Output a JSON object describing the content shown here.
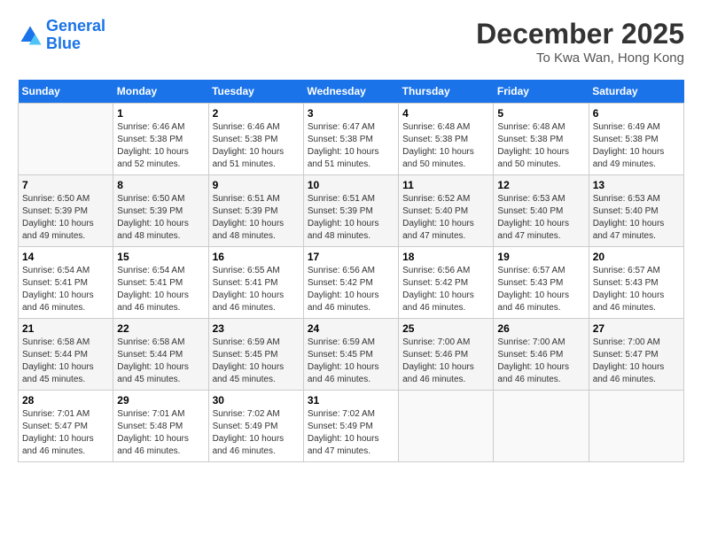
{
  "logo": {
    "line1": "General",
    "line2": "Blue"
  },
  "title": "December 2025",
  "subtitle": "To Kwa Wan, Hong Kong",
  "days_of_week": [
    "Sunday",
    "Monday",
    "Tuesday",
    "Wednesday",
    "Thursday",
    "Friday",
    "Saturday"
  ],
  "weeks": [
    [
      {
        "day": "",
        "sunrise": "",
        "sunset": "",
        "daylight": "",
        "empty": true
      },
      {
        "day": "1",
        "sunrise": "Sunrise: 6:46 AM",
        "sunset": "Sunset: 5:38 PM",
        "daylight": "Daylight: 10 hours and 52 minutes."
      },
      {
        "day": "2",
        "sunrise": "Sunrise: 6:46 AM",
        "sunset": "Sunset: 5:38 PM",
        "daylight": "Daylight: 10 hours and 51 minutes."
      },
      {
        "day": "3",
        "sunrise": "Sunrise: 6:47 AM",
        "sunset": "Sunset: 5:38 PM",
        "daylight": "Daylight: 10 hours and 51 minutes."
      },
      {
        "day": "4",
        "sunrise": "Sunrise: 6:48 AM",
        "sunset": "Sunset: 5:38 PM",
        "daylight": "Daylight: 10 hours and 50 minutes."
      },
      {
        "day": "5",
        "sunrise": "Sunrise: 6:48 AM",
        "sunset": "Sunset: 5:38 PM",
        "daylight": "Daylight: 10 hours and 50 minutes."
      },
      {
        "day": "6",
        "sunrise": "Sunrise: 6:49 AM",
        "sunset": "Sunset: 5:38 PM",
        "daylight": "Daylight: 10 hours and 49 minutes."
      }
    ],
    [
      {
        "day": "7",
        "sunrise": "Sunrise: 6:50 AM",
        "sunset": "Sunset: 5:39 PM",
        "daylight": "Daylight: 10 hours and 49 minutes."
      },
      {
        "day": "8",
        "sunrise": "Sunrise: 6:50 AM",
        "sunset": "Sunset: 5:39 PM",
        "daylight": "Daylight: 10 hours and 48 minutes."
      },
      {
        "day": "9",
        "sunrise": "Sunrise: 6:51 AM",
        "sunset": "Sunset: 5:39 PM",
        "daylight": "Daylight: 10 hours and 48 minutes."
      },
      {
        "day": "10",
        "sunrise": "Sunrise: 6:51 AM",
        "sunset": "Sunset: 5:39 PM",
        "daylight": "Daylight: 10 hours and 48 minutes."
      },
      {
        "day": "11",
        "sunrise": "Sunrise: 6:52 AM",
        "sunset": "Sunset: 5:40 PM",
        "daylight": "Daylight: 10 hours and 47 minutes."
      },
      {
        "day": "12",
        "sunrise": "Sunrise: 6:53 AM",
        "sunset": "Sunset: 5:40 PM",
        "daylight": "Daylight: 10 hours and 47 minutes."
      },
      {
        "day": "13",
        "sunrise": "Sunrise: 6:53 AM",
        "sunset": "Sunset: 5:40 PM",
        "daylight": "Daylight: 10 hours and 47 minutes."
      }
    ],
    [
      {
        "day": "14",
        "sunrise": "Sunrise: 6:54 AM",
        "sunset": "Sunset: 5:41 PM",
        "daylight": "Daylight: 10 hours and 46 minutes."
      },
      {
        "day": "15",
        "sunrise": "Sunrise: 6:54 AM",
        "sunset": "Sunset: 5:41 PM",
        "daylight": "Daylight: 10 hours and 46 minutes."
      },
      {
        "day": "16",
        "sunrise": "Sunrise: 6:55 AM",
        "sunset": "Sunset: 5:41 PM",
        "daylight": "Daylight: 10 hours and 46 minutes."
      },
      {
        "day": "17",
        "sunrise": "Sunrise: 6:56 AM",
        "sunset": "Sunset: 5:42 PM",
        "daylight": "Daylight: 10 hours and 46 minutes."
      },
      {
        "day": "18",
        "sunrise": "Sunrise: 6:56 AM",
        "sunset": "Sunset: 5:42 PM",
        "daylight": "Daylight: 10 hours and 46 minutes."
      },
      {
        "day": "19",
        "sunrise": "Sunrise: 6:57 AM",
        "sunset": "Sunset: 5:43 PM",
        "daylight": "Daylight: 10 hours and 46 minutes."
      },
      {
        "day": "20",
        "sunrise": "Sunrise: 6:57 AM",
        "sunset": "Sunset: 5:43 PM",
        "daylight": "Daylight: 10 hours and 46 minutes."
      }
    ],
    [
      {
        "day": "21",
        "sunrise": "Sunrise: 6:58 AM",
        "sunset": "Sunset: 5:44 PM",
        "daylight": "Daylight: 10 hours and 45 minutes."
      },
      {
        "day": "22",
        "sunrise": "Sunrise: 6:58 AM",
        "sunset": "Sunset: 5:44 PM",
        "daylight": "Daylight: 10 hours and 45 minutes."
      },
      {
        "day": "23",
        "sunrise": "Sunrise: 6:59 AM",
        "sunset": "Sunset: 5:45 PM",
        "daylight": "Daylight: 10 hours and 45 minutes."
      },
      {
        "day": "24",
        "sunrise": "Sunrise: 6:59 AM",
        "sunset": "Sunset: 5:45 PM",
        "daylight": "Daylight: 10 hours and 46 minutes."
      },
      {
        "day": "25",
        "sunrise": "Sunrise: 7:00 AM",
        "sunset": "Sunset: 5:46 PM",
        "daylight": "Daylight: 10 hours and 46 minutes."
      },
      {
        "day": "26",
        "sunrise": "Sunrise: 7:00 AM",
        "sunset": "Sunset: 5:46 PM",
        "daylight": "Daylight: 10 hours and 46 minutes."
      },
      {
        "day": "27",
        "sunrise": "Sunrise: 7:00 AM",
        "sunset": "Sunset: 5:47 PM",
        "daylight": "Daylight: 10 hours and 46 minutes."
      }
    ],
    [
      {
        "day": "28",
        "sunrise": "Sunrise: 7:01 AM",
        "sunset": "Sunset: 5:47 PM",
        "daylight": "Daylight: 10 hours and 46 minutes."
      },
      {
        "day": "29",
        "sunrise": "Sunrise: 7:01 AM",
        "sunset": "Sunset: 5:48 PM",
        "daylight": "Daylight: 10 hours and 46 minutes."
      },
      {
        "day": "30",
        "sunrise": "Sunrise: 7:02 AM",
        "sunset": "Sunset: 5:49 PM",
        "daylight": "Daylight: 10 hours and 46 minutes."
      },
      {
        "day": "31",
        "sunrise": "Sunrise: 7:02 AM",
        "sunset": "Sunset: 5:49 PM",
        "daylight": "Daylight: 10 hours and 47 minutes."
      },
      {
        "day": "",
        "sunrise": "",
        "sunset": "",
        "daylight": "",
        "empty": true
      },
      {
        "day": "",
        "sunrise": "",
        "sunset": "",
        "daylight": "",
        "empty": true
      },
      {
        "day": "",
        "sunrise": "",
        "sunset": "",
        "daylight": "",
        "empty": true
      }
    ]
  ]
}
